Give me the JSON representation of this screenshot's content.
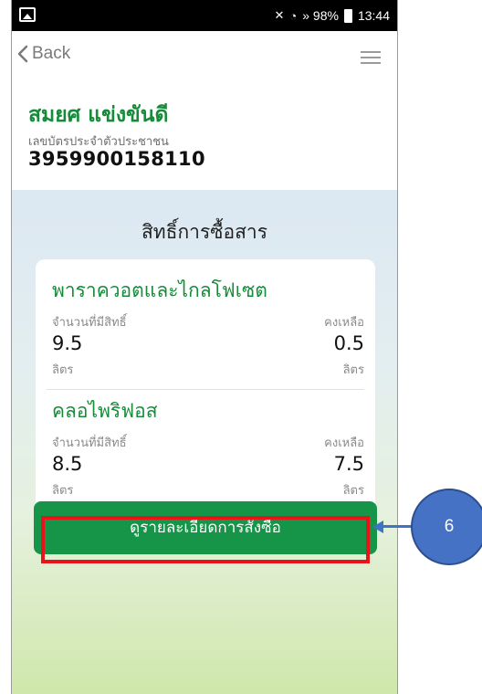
{
  "status_bar": {
    "signal_text": "» 98%",
    "time": "13:44",
    "icons": [
      "image-icon",
      "mute-icon",
      "wifi-icon",
      "signal-icon",
      "battery-icon"
    ]
  },
  "nav": {
    "back_label": "Back",
    "menu_icon": "hamburger-menu-icon"
  },
  "person": {
    "name": "สมยศ แข่งขันดี",
    "id_label": "เลขบัตรประจำตัวประชาชน",
    "id_number": "3959900158110"
  },
  "rights": {
    "title": "สิทธิ์การซื้อสาร",
    "items": [
      {
        "name": "พาราควอตและไกลโฟเซต",
        "entitled_label": "จำนวนที่มีสิทธิ์",
        "entitled_value": "9.5",
        "entitled_unit": "ลิตร",
        "remaining_label": "คงเหลือ",
        "remaining_value": "0.5",
        "remaining_unit": "ลิตร"
      },
      {
        "name": "คลอไพริฟอส",
        "entitled_label": "จำนวนที่มีสิทธิ์",
        "entitled_value": "8.5",
        "entitled_unit": "ลิตร",
        "remaining_label": "คงเหลือ",
        "remaining_value": "7.5",
        "remaining_unit": "ลิตร"
      }
    ]
  },
  "order_button_label": "ดูรายละเอียดการสั่งซื้อ",
  "annotation": {
    "step_number": "6",
    "highlight_color": "#e8141a",
    "callout_color": "#4672c6"
  },
  "colors": {
    "brand_green": "#178b3a",
    "button_green": "#169447"
  }
}
